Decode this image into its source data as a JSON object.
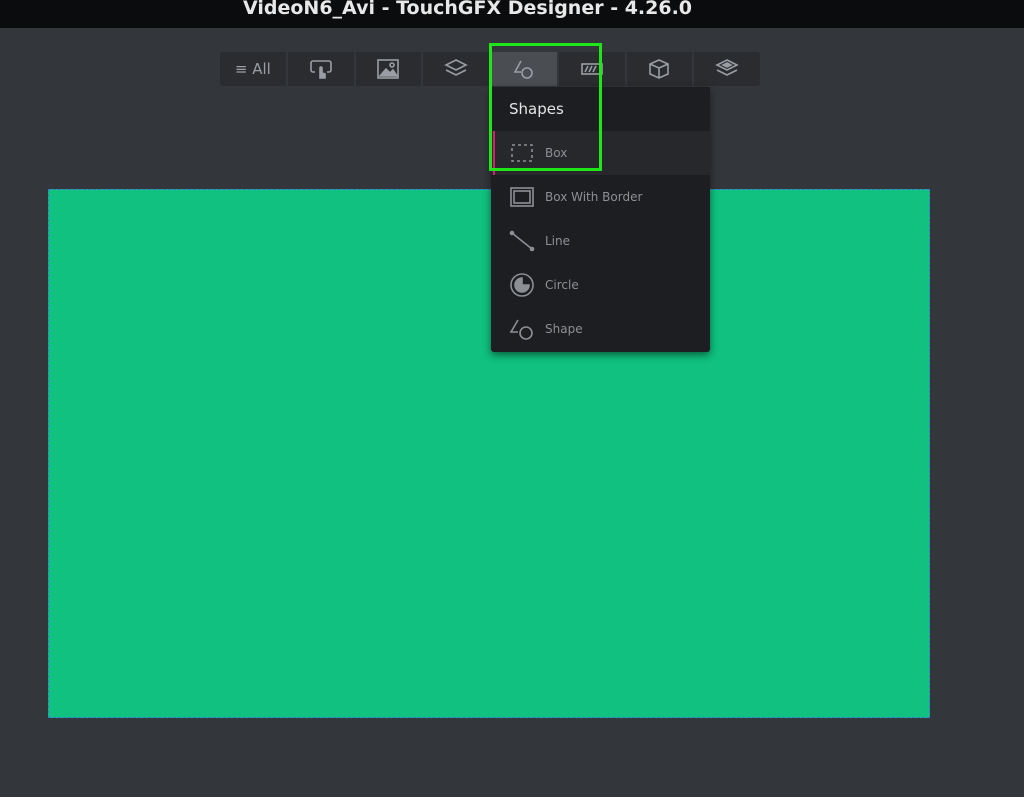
{
  "window": {
    "title": "VideoN6_Avi - TouchGFX Designer - 4.26.0"
  },
  "toolbar": {
    "all_label": "≡ All",
    "tabs": [
      "all",
      "interaction",
      "images",
      "containers",
      "shapes",
      "progress",
      "3d",
      "layers"
    ],
    "active": "shapes"
  },
  "menu": {
    "title": "Shapes",
    "items": [
      {
        "label": "Box",
        "icon": "box-icon"
      },
      {
        "label": "Box With Border",
        "icon": "box-with-border-icon"
      },
      {
        "label": "Line",
        "icon": "line-icon"
      },
      {
        "label": "Circle",
        "icon": "circle-icon"
      },
      {
        "label": "Shape",
        "icon": "shape-icon"
      }
    ],
    "selected": "Box"
  },
  "colors": {
    "canvas": "#10c17f",
    "highlight": "#1ee619",
    "selection": "#d6226e"
  }
}
